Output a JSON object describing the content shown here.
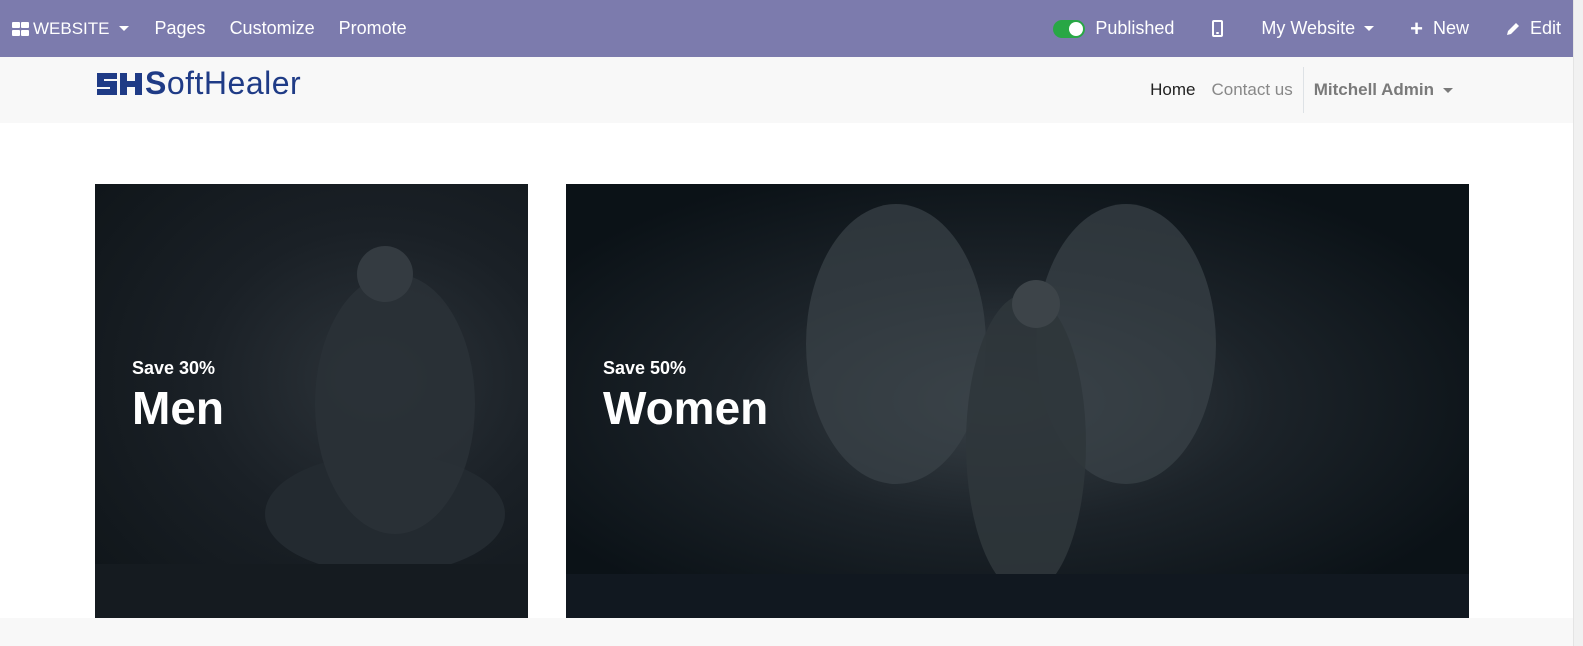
{
  "adminbar": {
    "website_label": "WEBSITE",
    "pages_label": "Pages",
    "customize_label": "Customize",
    "promote_label": "Promote",
    "published_label": "Published",
    "mywebsite_label": "My Website",
    "new_label": "New",
    "edit_label": "Edit",
    "bar_color": "#7c7bad",
    "toggle_color": "#28a745"
  },
  "header": {
    "logo_text_bold": "S",
    "logo_text_rest": "oftHealer",
    "logo_color": "#1f3b86",
    "nav": [
      "Home",
      "Contact us"
    ],
    "user": "Mitchell Admin"
  },
  "banners": [
    {
      "save": "Save 30%",
      "title": "Men"
    },
    {
      "save": "Save 50%",
      "title": "Women"
    }
  ]
}
